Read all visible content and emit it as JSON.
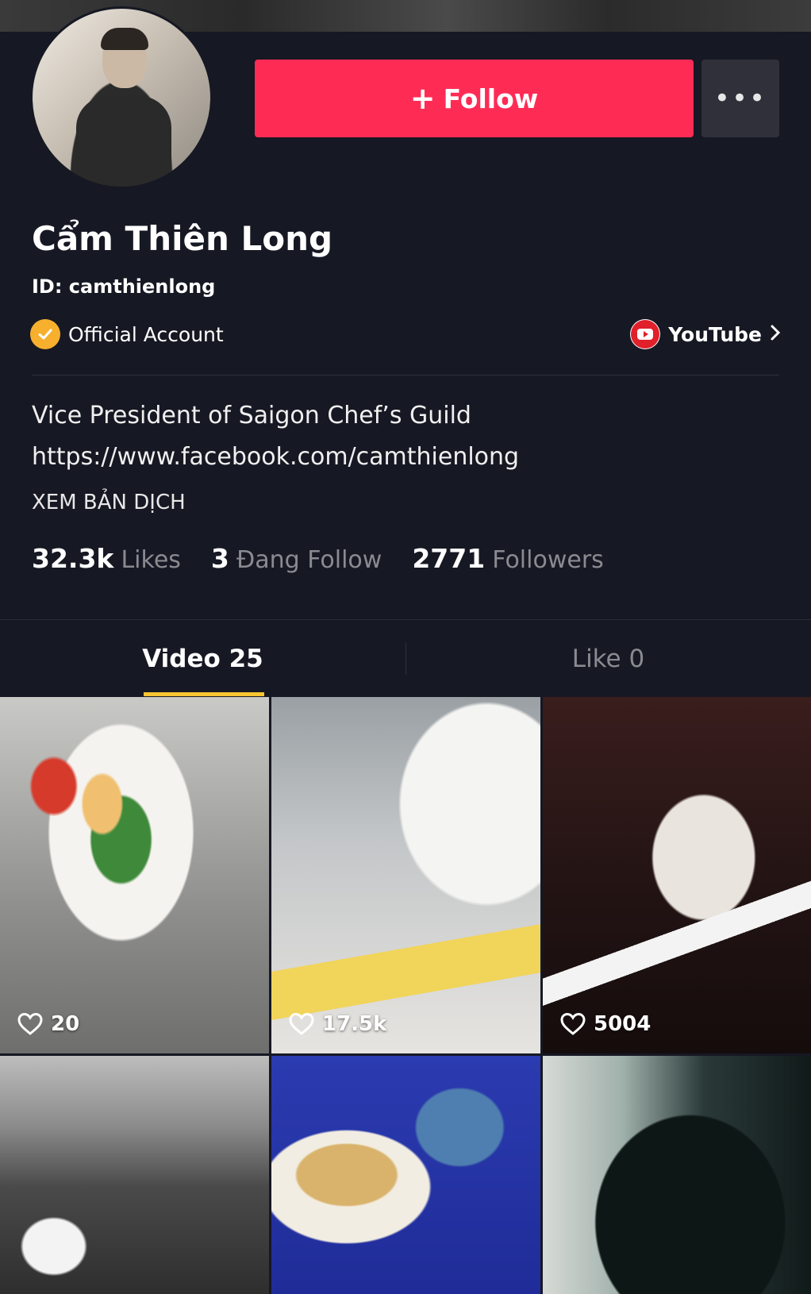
{
  "profile": {
    "display_name": "Cẩm Thiên Long",
    "user_id": "ID: camthienlong",
    "verified_label": "Official Account",
    "external_link": "YouTube",
    "bio_line1": "Vice President of Saigon Chef’s Guild",
    "bio_line2": "https://www.facebook.com/camthienlong",
    "translate_label": "XEM BẢN DỊCH"
  },
  "actions": {
    "follow_label": "Follow",
    "more_label": "•••"
  },
  "stats": {
    "likes_value": "32.3k",
    "likes_label": "Likes",
    "following_value": "3",
    "following_label": "Đang Follow",
    "followers_value": "2771",
    "followers_label": "Followers"
  },
  "tabs": {
    "video_label": "Video 25",
    "like_label": "Like 0"
  },
  "videos": [
    {
      "likes": "20"
    },
    {
      "likes": "17.5k"
    },
    {
      "likes": "5004"
    },
    {
      "likes": ""
    },
    {
      "likes": ""
    },
    {
      "likes": ""
    }
  ],
  "colors": {
    "background": "#161823",
    "follow_button": "#fe2c55",
    "verified_badge": "#f7b02e",
    "youtube_red": "#e0202a",
    "tab_indicator": "#f7c531",
    "muted_text": "#8a8b91"
  }
}
